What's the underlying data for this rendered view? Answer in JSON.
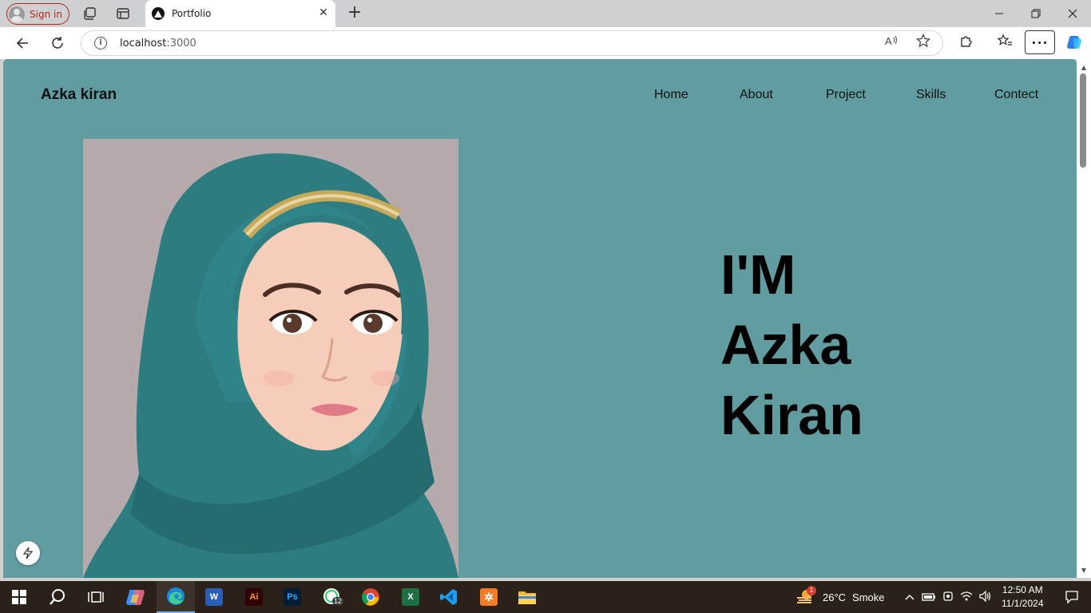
{
  "browser": {
    "signin_label": "Sign in",
    "tab_title": "Portfolio",
    "url_host": "localhost",
    "url_port": ":3000"
  },
  "page": {
    "brand": "Azka kiran",
    "nav": [
      "Home",
      "About",
      "Project",
      "Skills",
      "Contect"
    ],
    "hero_lines": [
      "I'M",
      "Azka",
      "Kiran"
    ],
    "background_color": "#609ca0"
  },
  "taskbar": {
    "apps": [
      "start",
      "search",
      "task-view",
      "copilot",
      "edge",
      "word",
      "illustrator",
      "photoshop",
      "whatsapp",
      "chrome",
      "excel",
      "vscode",
      "xampp",
      "file-explorer"
    ],
    "whatsapp_badge": "12",
    "weather_temp": "26°C",
    "weather_text": "Smoke",
    "weather_badge": "1",
    "time": "12:50 AM",
    "date": "11/1/2024"
  }
}
